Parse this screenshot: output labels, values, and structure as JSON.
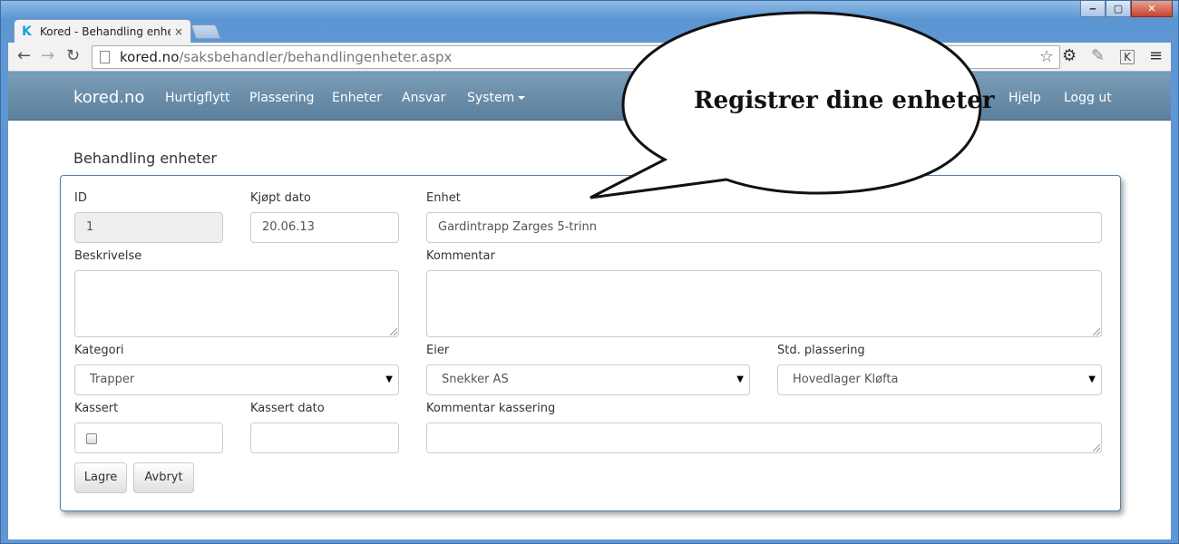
{
  "browser": {
    "tab_title": "Kored - Behandling enhet",
    "tab_close": "×",
    "url_domain": "kored.no",
    "url_path": "/saksbehandler/behandlingenheter.aspx",
    "window_controls": {
      "minimize": "‒",
      "maximize": "▢",
      "close": "✕"
    }
  },
  "navbar": {
    "brand": "kored.no",
    "items": [
      "Hurtigflytt",
      "Plassering",
      "Enheter",
      "Ansvar",
      "System"
    ],
    "right_items": [
      "Hjelp",
      "Logg ut"
    ]
  },
  "page": {
    "heading": "Behandling enheter"
  },
  "form": {
    "id_label": "ID",
    "id_value": "1",
    "kjopt_dato_label": "Kjøpt dato",
    "kjopt_dato_value": "20.06.13",
    "enhet_label": "Enhet",
    "enhet_value": "Gardintrapp Zarges 5-trinn",
    "beskrivelse_label": "Beskrivelse",
    "beskrivelse_value": "",
    "kommentar_label": "Kommentar",
    "kommentar_value": "",
    "kategori_label": "Kategori",
    "kategori_value": "Trapper",
    "eier_label": "Eier",
    "eier_value": "Snekker AS",
    "std_plassering_label": "Std. plassering",
    "std_plassering_value": "Hovedlager Kløfta",
    "kassert_label": "Kassert",
    "kassert_checked": false,
    "kassert_dato_label": "Kassert dato",
    "kassert_dato_value": "",
    "kommentar_kassering_label": "Kommentar kassering",
    "kommentar_kassering_value": "",
    "save_label": "Lagre",
    "cancel_label": "Avbryt"
  },
  "callout": {
    "text": "Registrer dine enheter"
  },
  "icons": {
    "favicon": "K",
    "back": "←",
    "forward": "→",
    "reload": "↻",
    "star": "☆",
    "settings": "⚙",
    "extension": "K",
    "menu": "≡",
    "select_arrow": "▼"
  }
}
